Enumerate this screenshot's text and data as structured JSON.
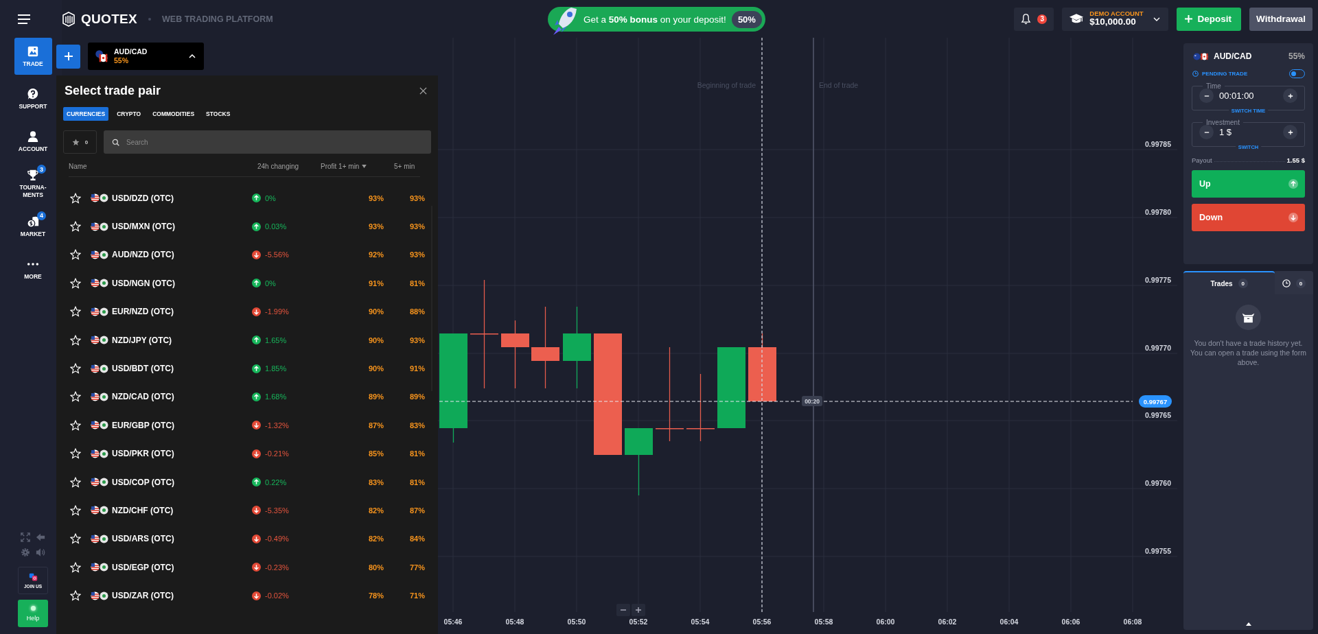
{
  "top_bar": {
    "brand": "QUOTEX",
    "tagline": "WEB TRADING PLATFORM",
    "promo": {
      "text": "Get a **50% bonus** on your deposit!",
      "badge": "50%"
    },
    "notifications": "3",
    "account": {
      "type": "DEMO ACCOUNT",
      "balance": "$10,000.00"
    },
    "deposit": "Deposit",
    "withdrawal": "Withdrawal"
  },
  "sidebar": {
    "items": [
      {
        "kind": "trade",
        "label": "TRADE",
        "selected": true
      },
      {
        "kind": "support",
        "label": "SUPPORT",
        "selected": false
      },
      {
        "kind": "account",
        "label": "ACCOUNT",
        "selected": false
      },
      {
        "kind": "tournaments",
        "label": "TOURNA-MENTS",
        "selected": false,
        "badge": "3"
      },
      {
        "kind": "market",
        "label": "MARKET",
        "selected": false,
        "badge": "4"
      },
      {
        "kind": "more",
        "label": "MORE",
        "selected": false
      }
    ],
    "join": "JOIN US",
    "help": "Help"
  },
  "asset_chip": {
    "pair": "AUD/CAD",
    "payout": "55%",
    "expanded": true
  },
  "pair_panel": {
    "title": "Select trade pair",
    "tabs": [
      {
        "label": "CURRENCIES",
        "selected": true
      },
      {
        "label": "CRYPTO",
        "selected": false
      },
      {
        "label": "COMMODITIES",
        "selected": false
      },
      {
        "label": "STOCKS",
        "selected": false
      }
    ],
    "favorites": "0",
    "search": {
      "placeholder": "Search"
    },
    "columns": [
      {
        "label": "Name",
        "sorted": false
      },
      {
        "label": "24h changing",
        "sorted": false
      },
      {
        "label": "Profit 1+ min",
        "sorted": true
      },
      {
        "label": "5+ min",
        "sorted": false
      }
    ],
    "rows": [
      {
        "name": "USD/DZD (OTC)",
        "change": "0%",
        "rising": true,
        "profit_1": "93%",
        "profit_5": "93%"
      },
      {
        "name": "USD/MXN (OTC)",
        "change": "0.03%",
        "rising": true,
        "profit_1": "93%",
        "profit_5": "93%"
      },
      {
        "name": "AUD/NZD (OTC)",
        "change": "-5.56%",
        "rising": false,
        "profit_1": "92%",
        "profit_5": "93%"
      },
      {
        "name": "USD/NGN (OTC)",
        "change": "0%",
        "rising": true,
        "profit_1": "91%",
        "profit_5": "81%"
      },
      {
        "name": "EUR/NZD (OTC)",
        "change": "-1.99%",
        "rising": false,
        "profit_1": "90%",
        "profit_5": "88%"
      },
      {
        "name": "NZD/JPY (OTC)",
        "change": "1.65%",
        "rising": true,
        "profit_1": "90%",
        "profit_5": "93%"
      },
      {
        "name": "USD/BDT (OTC)",
        "change": "1.85%",
        "rising": true,
        "profit_1": "90%",
        "profit_5": "91%"
      },
      {
        "name": "NZD/CAD (OTC)",
        "change": "1.68%",
        "rising": true,
        "profit_1": "89%",
        "profit_5": "89%"
      },
      {
        "name": "EUR/GBP (OTC)",
        "change": "-1.32%",
        "rising": false,
        "profit_1": "87%",
        "profit_5": "83%"
      },
      {
        "name": "USD/PKR (OTC)",
        "change": "-0.21%",
        "rising": false,
        "profit_1": "85%",
        "profit_5": "81%"
      },
      {
        "name": "USD/COP (OTC)",
        "change": "0.22%",
        "rising": true,
        "profit_1": "83%",
        "profit_5": "81%"
      },
      {
        "name": "NZD/CHF (OTC)",
        "change": "-5.35%",
        "rising": false,
        "profit_1": "82%",
        "profit_5": "87%"
      },
      {
        "name": "USD/ARS (OTC)",
        "change": "-0.49%",
        "rising": false,
        "profit_1": "82%",
        "profit_5": "84%"
      },
      {
        "name": "USD/EGP (OTC)",
        "change": "-0.23%",
        "rising": false,
        "profit_1": "80%",
        "profit_5": "77%"
      },
      {
        "name": "USD/ZAR (OTC)",
        "change": "-0.02%",
        "rising": false,
        "profit_1": "78%",
        "profit_5": "71%"
      }
    ]
  },
  "chart": {
    "begin_label": "Beginning of trade",
    "end_label": "End of trade",
    "y_labels": [
      "0.99785",
      "0.99780",
      "0.99775",
      "0.99770",
      "0.99765",
      "0.99760",
      "0.99755"
    ],
    "x_labels": [
      "05:46",
      "05:48",
      "05:50",
      "05:52",
      "05:54",
      "05:56",
      "05:58",
      "06:00",
      "06:02",
      "06:04",
      "06:06",
      "06:08"
    ],
    "price": "0.99767",
    "timer": "00:20"
  },
  "trade_form": {
    "pair": "AUD/CAD",
    "payout": "55%",
    "pending": {
      "label": "PENDING TRADE",
      "on": false
    },
    "time": {
      "label": "Time",
      "value": "00:01:00",
      "switch": "SWITCH TIME"
    },
    "investment": {
      "label": "Investment",
      "value": "1 $",
      "switch": "SWITCH"
    },
    "payout_label": "Payout",
    "payout_value": "1.55 $",
    "up": "Up",
    "down": "Down"
  },
  "trades": {
    "tabs": [
      {
        "kind": "trades",
        "label": "Trades",
        "count": "0",
        "selected": true
      },
      {
        "kind": "history",
        "count": "0",
        "selected": false
      }
    ],
    "empty": "You don't have a trade history yet. You can open a trade using the form above."
  }
}
